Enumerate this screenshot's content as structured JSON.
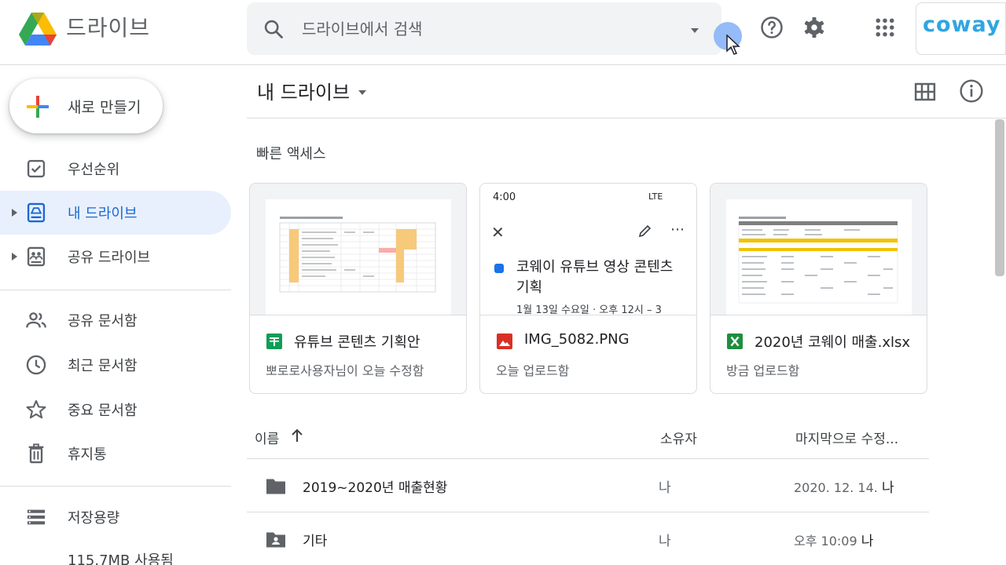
{
  "header": {
    "app_name": "드라이브",
    "search_placeholder": "드라이브에서 검색",
    "brand": "coway"
  },
  "sidebar": {
    "new_button_label": "새로 만들기",
    "items": [
      {
        "label": "우선순위",
        "icon": "priority-checkbox-icon"
      },
      {
        "label": "내 드라이브",
        "icon": "my-drive-icon",
        "active": true
      },
      {
        "label": "공유 드라이브",
        "icon": "shared-drives-icon"
      },
      {
        "label": "공유 문서함",
        "icon": "people-icon"
      },
      {
        "label": "최근 문서함",
        "icon": "clock-icon"
      },
      {
        "label": "중요 문서함",
        "icon": "star-icon"
      },
      {
        "label": "휴지통",
        "icon": "trash-icon"
      },
      {
        "label": "저장용량",
        "icon": "storage-icon"
      }
    ],
    "storage_used": "115.7MB 사용됨"
  },
  "main": {
    "title": "내 드라이브",
    "quick_access_title": "빠른 액세스",
    "cards": [
      {
        "name": "유튜브 콘텐츠 기획안",
        "subtitle": "뽀로로사용자님이 오늘 수정함",
        "icon": "sheets-icon"
      },
      {
        "name": "IMG_5082.PNG",
        "subtitle": "오늘 업로드함",
        "icon": "image-file-icon",
        "preview": {
          "time": "4:00",
          "status": "LTE",
          "title": "코웨이 유튜브 영상 콘텐츠 기획",
          "date": "1월 13일 수요일 · 오후 12시 – 3"
        }
      },
      {
        "name": "2020년 코웨이 매출.xlsx",
        "subtitle": "방금 업로드함",
        "icon": "excel-icon"
      }
    ],
    "list": {
      "columns": {
        "name": "이름",
        "owner": "소유자",
        "modified": "마지막으로 수정..."
      },
      "rows": [
        {
          "name": "2019~2020년 매출현황",
          "owner": "나",
          "date": "2020. 12. 14.",
          "by": "나",
          "icon": "folder-icon"
        },
        {
          "name": "기타",
          "owner": "나",
          "date": "오후 10:09",
          "by": "나",
          "icon": "shared-folder-icon"
        }
      ]
    }
  },
  "colors": {
    "accent": "#1967d2",
    "active_bg": "#e8f0fe",
    "brand": "#2fa6e0"
  }
}
